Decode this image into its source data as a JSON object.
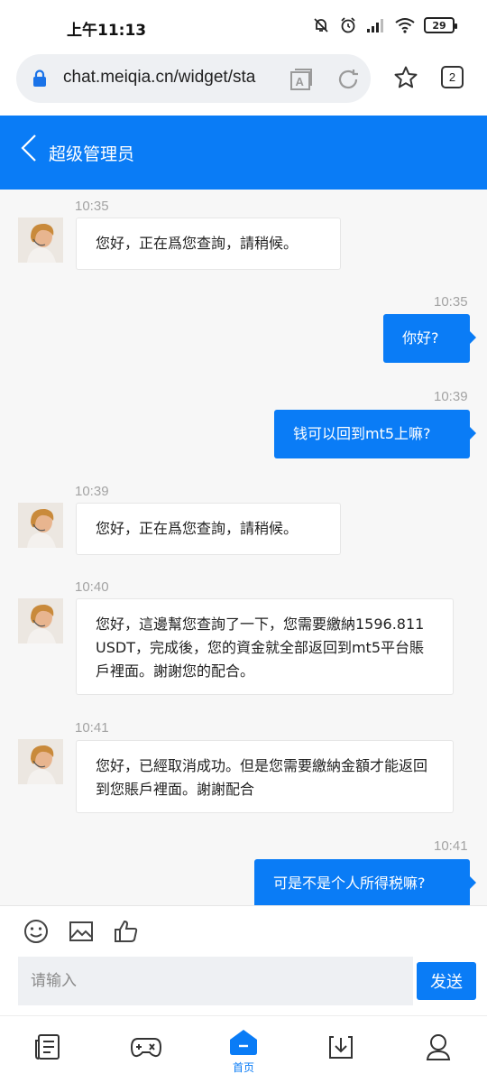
{
  "status_bar": {
    "time": "上午11:13",
    "battery": "29"
  },
  "browser": {
    "url": "chat.meiqia.cn/widget/sta",
    "tab_count": "2"
  },
  "header": {
    "title": "超级管理员"
  },
  "messages": [
    {
      "side": "left",
      "time": "10:35",
      "text": "您好，正在爲您查詢，請稍候。"
    },
    {
      "side": "right",
      "time": "10:35",
      "text": "你好?"
    },
    {
      "side": "right",
      "time": "10:39",
      "text": "钱可以回到mt5上嘛?"
    },
    {
      "side": "left",
      "time": "10:39",
      "text": "您好，正在爲您查詢，請稍候。"
    },
    {
      "side": "left",
      "time": "10:40",
      "text": "您好，這邊幫您查詢了一下，您需要繳納1596.811USDT，完成後，您的資金就全部返回到mt5平台賬戶裡面。謝謝您的配合。"
    },
    {
      "side": "left",
      "time": "10:41",
      "text": "您好，已經取消成功。但是您需要繳納金額才能返回到您賬戶裡面。謝謝配合"
    },
    {
      "side": "right",
      "time": "10:41",
      "text": "可是不是个人所得税嘛?"
    }
  ],
  "composer": {
    "placeholder": "请输入",
    "send_label": "发送"
  },
  "bottom_nav": {
    "home_label": "首页"
  },
  "colors": {
    "accent": "#0a7cf6",
    "bubble_left": "#ffffff",
    "chat_bg": "#f7f7f7"
  },
  "icons": [
    "lock-icon",
    "reader-mode-icon",
    "reload-icon",
    "star-icon",
    "back-icon",
    "emoji-icon",
    "image-icon",
    "thumbs-up-icon",
    "news-icon",
    "gamepad-icon",
    "home-icon",
    "download-icon",
    "profile-icon"
  ]
}
